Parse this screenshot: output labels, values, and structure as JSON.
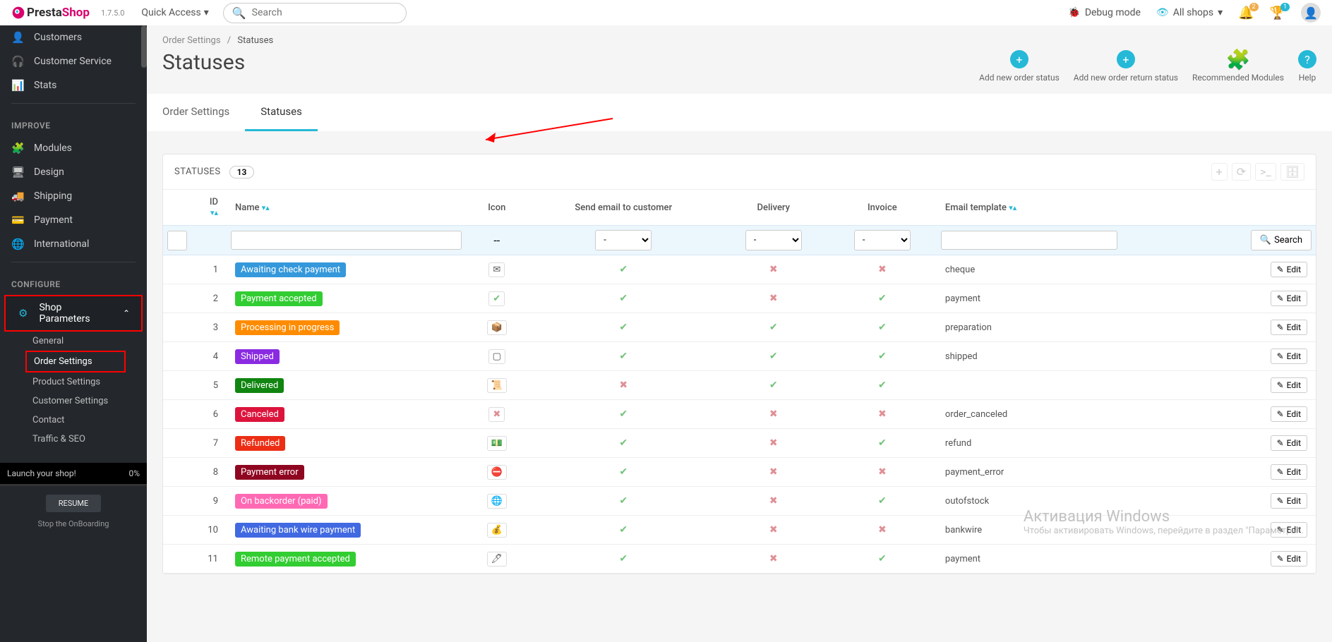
{
  "brand": {
    "name1": "Presta",
    "name2": "Shop",
    "version": "1.7.5.0"
  },
  "topbar": {
    "quick_access": "Quick Access",
    "search_placeholder": "Search",
    "debug": "Debug mode",
    "shops": "All shops",
    "notif1": "2",
    "notif2": "1"
  },
  "sidebar": {
    "items_top": [
      {
        "icon": "👤",
        "label": "Customers"
      },
      {
        "icon": "🎧",
        "label": "Customer Service"
      },
      {
        "icon": "📊",
        "label": "Stats"
      }
    ],
    "heading_improve": "IMPROVE",
    "items_improve": [
      {
        "icon": "🧩",
        "label": "Modules"
      },
      {
        "icon": "🖥",
        "label": "Design"
      },
      {
        "icon": "🚚",
        "label": "Shipping"
      },
      {
        "icon": "💳",
        "label": "Payment"
      },
      {
        "icon": "🌐",
        "label": "International"
      }
    ],
    "heading_configure": "CONFIGURE",
    "shop_params": "Shop Parameters",
    "subitems": [
      "General",
      "Order Settings",
      "Product Settings",
      "Customer Settings",
      "Contact",
      "Traffic & SEO"
    ],
    "launch": "Launch your shop!",
    "launch_pct": "0%",
    "resume": "RESUME",
    "stop": "Stop the OnBoarding"
  },
  "breadcrumb": {
    "a": "Order Settings",
    "b": "Statuses"
  },
  "page_title": "Statuses",
  "head_actions": [
    "Add new order status",
    "Add new order return status",
    "Recommended Modules",
    "Help"
  ],
  "tabs": [
    "Order Settings",
    "Statuses"
  ],
  "panel": {
    "title": "STATUSES",
    "count": "13"
  },
  "table": {
    "headers": {
      "id": "ID",
      "name": "Name",
      "icon": "Icon",
      "email": "Send email to customer",
      "delivery": "Delivery",
      "invoice": "Invoice",
      "template": "Email template"
    },
    "filter_dash": "--",
    "filter_select": "-",
    "search_btn": "Search",
    "edit_btn": "Edit",
    "rows": [
      {
        "id": 1,
        "name": "Awaiting check payment",
        "color": "#3498db",
        "icon": "✉",
        "email": true,
        "delivery": false,
        "invoice": false,
        "template": "cheque"
      },
      {
        "id": 2,
        "name": "Payment accepted",
        "color": "#32cd32",
        "icon": "✔",
        "icon_green": true,
        "email": true,
        "delivery": false,
        "invoice": true,
        "template": "payment"
      },
      {
        "id": 3,
        "name": "Processing in progress",
        "color": "#ff8c00",
        "icon": "📦",
        "email": true,
        "delivery": true,
        "invoice": true,
        "template": "preparation"
      },
      {
        "id": 4,
        "name": "Shipped",
        "color": "#8a2be2",
        "icon": "▢",
        "email": true,
        "delivery": true,
        "invoice": true,
        "template": "shipped"
      },
      {
        "id": 5,
        "name": "Delivered",
        "color": "#108510",
        "icon": "📜",
        "email": false,
        "delivery": true,
        "invoice": true,
        "template": ""
      },
      {
        "id": 6,
        "name": "Canceled",
        "color": "#dc143c",
        "icon": "✖",
        "icon_red": true,
        "email": true,
        "delivery": false,
        "invoice": false,
        "template": "order_canceled"
      },
      {
        "id": 7,
        "name": "Refunded",
        "color": "#ec2e15",
        "icon": "💵",
        "email": true,
        "delivery": false,
        "invoice": true,
        "template": "refund"
      },
      {
        "id": 8,
        "name": "Payment error",
        "color": "#8f0621",
        "icon": "⛔",
        "email": true,
        "delivery": false,
        "invoice": false,
        "template": "payment_error"
      },
      {
        "id": 9,
        "name": "On backorder (paid)",
        "color": "#ff69b4",
        "icon": "🌐",
        "email": true,
        "delivery": false,
        "invoice": true,
        "template": "outofstock"
      },
      {
        "id": 10,
        "name": "Awaiting bank wire payment",
        "color": "#4169e1",
        "icon": "💰",
        "email": true,
        "delivery": false,
        "invoice": false,
        "template": "bankwire"
      },
      {
        "id": 11,
        "name": "Remote payment accepted",
        "color": "#32cd32",
        "icon": "🖊",
        "email": true,
        "delivery": false,
        "invoice": true,
        "template": "payment"
      }
    ]
  },
  "watermark": {
    "title": "Активация Windows",
    "sub": "Чтобы активировать Windows, перейдите в раздел \"Параметры\"."
  }
}
